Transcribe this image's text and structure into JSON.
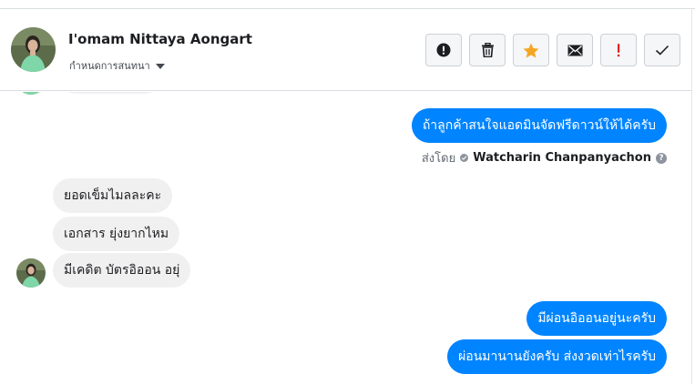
{
  "header": {
    "name": "I'omam Nittaya Aongart",
    "assign_label": "กำหนดการสนทนา",
    "actions": [
      {
        "icon": "alert-circle-icon",
        "color": "#1c1e21"
      },
      {
        "icon": "trash-icon",
        "color": "#1c1e21"
      },
      {
        "icon": "star-icon",
        "color": "#f5a623"
      },
      {
        "icon": "envelope-icon",
        "color": "#1c1e21"
      },
      {
        "icon": "exclamation-icon",
        "color": "#e02424"
      },
      {
        "icon": "checkmark-icon",
        "color": "#1c1e21"
      }
    ]
  },
  "messages": [
    {
      "direction": "out",
      "text": "ถ้าลูกค้าสนใจแอดมินจัดฟรีดาวน์ให้ได้ครับ"
    },
    {
      "direction": "in",
      "text": "ยอดเข็มไมลละคะ"
    },
    {
      "direction": "in",
      "text": "เอกสาร ยุ่งยากไหม"
    },
    {
      "direction": "in",
      "text": "มีเคดิต บัตรอิออน อยุ่"
    },
    {
      "direction": "out",
      "text": "มีผ่อนอิออนอยู่นะครับ"
    },
    {
      "direction": "out",
      "text": "ผ่อนมานานยังครับ ส่งงวดเท่าไรครับ"
    }
  ],
  "sent_by": {
    "prefix": "ส่งโดย",
    "sender": "Watcharin Chanpanyachon",
    "help": "?"
  },
  "colors": {
    "outgoing_bubble": "#0084ff",
    "incoming_bubble": "#f1f0f0",
    "border": "#dadde1"
  }
}
